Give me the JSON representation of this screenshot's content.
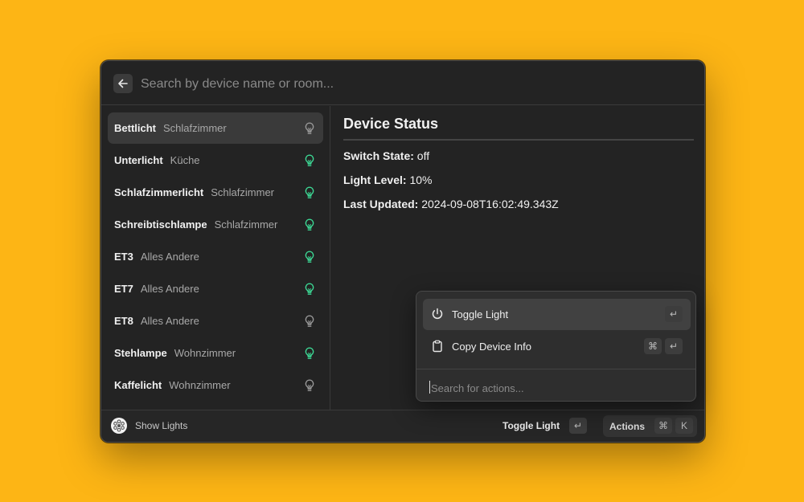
{
  "search": {
    "placeholder": "Search by device name or room..."
  },
  "devices": [
    {
      "name": "Bettlicht",
      "room": "Schlafzimmer",
      "on": false,
      "selected": true
    },
    {
      "name": "Unterlicht",
      "room": "Küche",
      "on": true
    },
    {
      "name": "Schlafzimmerlicht",
      "room": "Schlafzimmer",
      "on": true
    },
    {
      "name": "Schreibtischlampe",
      "room": "Schlafzimmer",
      "on": true
    },
    {
      "name": "ET3",
      "room": "Alles Andere",
      "on": true
    },
    {
      "name": "ET7",
      "room": "Alles Andere",
      "on": true
    },
    {
      "name": "ET8",
      "room": "Alles Andere",
      "on": false
    },
    {
      "name": "Stehlampe",
      "room": "Wohnzimmer",
      "on": true
    },
    {
      "name": "Kaffelicht",
      "room": "Wohnzimmer",
      "on": false
    }
  ],
  "detail": {
    "title": "Device Status",
    "switch_label": "Switch State:",
    "switch_value": "off",
    "level_label": "Light Level:",
    "level_value": "10%",
    "updated_label": "Last Updated:",
    "updated_value": "2024-09-08T16:02:49.343Z"
  },
  "footer": {
    "title": "Show Lights",
    "primary_action": "Toggle Light",
    "enter_key": "↵",
    "actions_label": "Actions",
    "cmd_key": "⌘",
    "k_key": "K"
  },
  "action_panel": {
    "items": [
      {
        "label": "Toggle Light",
        "keys": [
          "↵"
        ]
      },
      {
        "label": "Copy Device Info",
        "keys": [
          "⌘",
          "↵"
        ]
      }
    ],
    "search_placeholder": "Search for actions..."
  },
  "colors": {
    "background": "#FDB515",
    "bulb_on": "#3DDC97",
    "bulb_off": "#9A9A9A"
  }
}
